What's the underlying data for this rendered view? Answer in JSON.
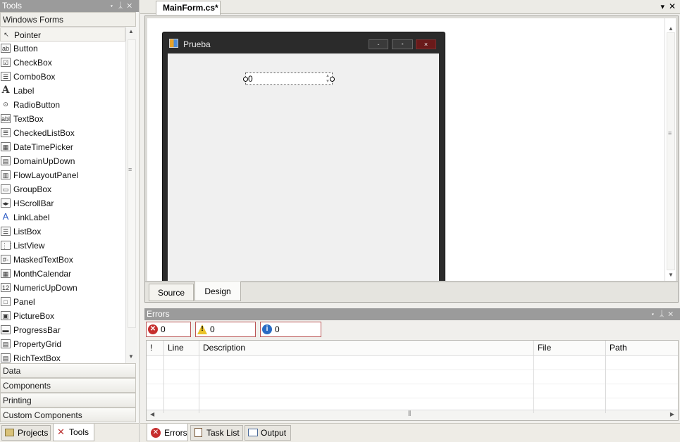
{
  "tools_panel": {
    "title": "Tools",
    "section": "Windows Forms",
    "items": [
      {
        "label": "Pointer",
        "icon": "pointer-icon"
      },
      {
        "label": "Button",
        "icon": "button-icon"
      },
      {
        "label": "CheckBox",
        "icon": "checkbox-icon"
      },
      {
        "label": "ComboBox",
        "icon": "combobox-icon"
      },
      {
        "label": "Label",
        "icon": "label-icon"
      },
      {
        "label": "RadioButton",
        "icon": "radiobutton-icon"
      },
      {
        "label": "TextBox",
        "icon": "textbox-icon"
      },
      {
        "label": "CheckedListBox",
        "icon": "checkedlistbox-icon"
      },
      {
        "label": "DateTimePicker",
        "icon": "datetimepicker-icon"
      },
      {
        "label": "DomainUpDown",
        "icon": "domainupdown-icon"
      },
      {
        "label": "FlowLayoutPanel",
        "icon": "flowlayoutpanel-icon"
      },
      {
        "label": "GroupBox",
        "icon": "groupbox-icon"
      },
      {
        "label": "HScrollBar",
        "icon": "hscrollbar-icon"
      },
      {
        "label": "LinkLabel",
        "icon": "linklabel-icon"
      },
      {
        "label": "ListBox",
        "icon": "listbox-icon"
      },
      {
        "label": "ListView",
        "icon": "listview-icon"
      },
      {
        "label": "MaskedTextBox",
        "icon": "maskedtextbox-icon"
      },
      {
        "label": "MonthCalendar",
        "icon": "monthcalendar-icon"
      },
      {
        "label": "NumericUpDown",
        "icon": "numericupdown-icon"
      },
      {
        "label": "Panel",
        "icon": "panel-icon"
      },
      {
        "label": "PictureBox",
        "icon": "picturebox-icon"
      },
      {
        "label": "ProgressBar",
        "icon": "progressbar-icon"
      },
      {
        "label": "PropertyGrid",
        "icon": "propertygrid-icon"
      },
      {
        "label": "RichTextBox",
        "icon": "richtextbox-icon"
      }
    ],
    "icon_glyphs": [
      "↖",
      "ab",
      "☑",
      "☰",
      "A",
      "⊙",
      "abl",
      "☰",
      "▦",
      "▤",
      "▥",
      "▭",
      "◂▸",
      "A",
      "☰",
      "⋮⋮",
      "#-",
      "▦",
      "12",
      "□",
      "▣",
      "▬",
      "▤",
      "▤"
    ],
    "categories": [
      "Data",
      "Components",
      "Printing",
      "Custom Components"
    ]
  },
  "left_bottom_tabs": [
    "Projects",
    "Tools"
  ],
  "document": {
    "tab_title": "MainForm.cs*",
    "bottom_tabs": [
      "Source",
      "Design"
    ],
    "form": {
      "title": "Prueba",
      "numeric_value": "0",
      "caption_buttons": [
        "-",
        "▫",
        "×"
      ]
    }
  },
  "errors_panel": {
    "title": "Errors",
    "filters": [
      "0 Errors",
      "0 Warnings",
      "0 Messages"
    ],
    "columns": [
      "!",
      "Line",
      "Description",
      "File",
      "Path"
    ]
  },
  "bottom_tabs": [
    "Errors",
    "Task List",
    "Output"
  ]
}
